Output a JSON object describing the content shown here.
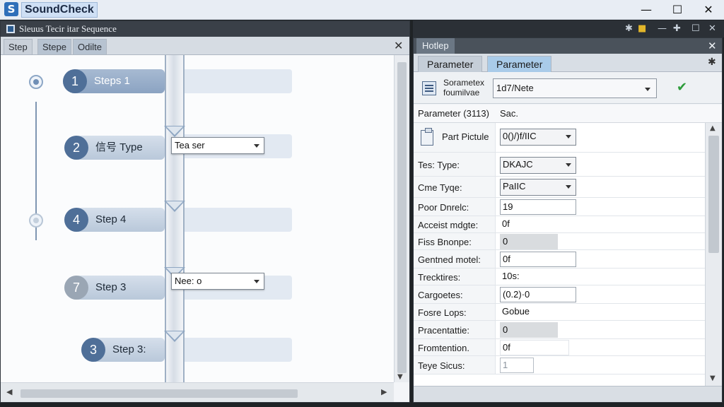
{
  "window": {
    "app_logo": "S",
    "app_title": "SoundCheck",
    "minimize": "—",
    "maximize": "☐",
    "close": "✕"
  },
  "left_pane": {
    "header_title": "Sleuus Tecir itar Sequence",
    "tabs": [
      {
        "label": "Step",
        "active": false
      },
      {
        "label": "Stepe",
        "active": true
      },
      {
        "label": "Odilte",
        "active": true
      }
    ],
    "close": "✕",
    "steps": [
      {
        "number": "1",
        "label": "Steps 1",
        "style": "primary"
      },
      {
        "number": "2",
        "label": "信号 Type",
        "style": "normal"
      },
      {
        "number": "4",
        "label": "Step 4",
        "style": "normal"
      },
      {
        "number": "7",
        "label": "Step 3",
        "style": "grey"
      },
      {
        "number": "3",
        "label": "Step 3:",
        "style": "normal"
      }
    ],
    "combos": [
      {
        "value": "Tea ser"
      },
      {
        "value": "Nee: o"
      }
    ],
    "scroll": {
      "left_arrow": "◀",
      "right_arrow": "▶",
      "down_arrow": "▼"
    }
  },
  "right_pane": {
    "toolbar_icons": [
      "pin-icon",
      "collapse-icon",
      "minimize-icon",
      "restore-icon",
      "close-icon"
    ],
    "header_title": "Hotlep",
    "close": "✕",
    "pin": "✱",
    "tabs": [
      {
        "label": "Parameter",
        "active": false
      },
      {
        "label": "Parameter",
        "active": true
      }
    ],
    "selector": {
      "label": "Sorametex foumilvae",
      "value": "1d7/Nete",
      "confirm": "✔"
    },
    "table_header": {
      "key": "Parameter (3113)",
      "value": "Sac."
    },
    "properties": [
      {
        "key": "Part Pictule",
        "value": "0()/)f/IIC",
        "kind": "dropdown",
        "icon": "clipboard-icon"
      },
      {
        "key": "Tes: Type:",
        "value": "DKAJC",
        "kind": "dropdown"
      },
      {
        "key": "Cme Tyqe:",
        "value": "PaIIC",
        "kind": "dropdown"
      },
      {
        "key": "Poor Dnrelc:",
        "value": "19",
        "kind": "box"
      },
      {
        "key": "Acceist mdgte:",
        "value": "0f",
        "kind": "plain"
      },
      {
        "key": "Fiss Bnonpe:",
        "value": "0",
        "kind": "grey"
      },
      {
        "key": "Gentned motel:",
        "value": "0f",
        "kind": "box"
      },
      {
        "key": "Trecktires:",
        "value": "10s:",
        "kind": "plain"
      },
      {
        "key": "Cargoetes:",
        "value": "(0.2)·0",
        "kind": "box"
      },
      {
        "key": "Fosre Lops:",
        "value": "Gobue",
        "kind": "plain"
      },
      {
        "key": "Pracentattie:",
        "value": "0",
        "kind": "grey"
      },
      {
        "key": "Fromtention.",
        "value": "0f",
        "kind": "box"
      },
      {
        "key": "Teye Sicus:",
        "value": "1",
        "kind": "faint"
      }
    ],
    "scroll": {
      "up": "▲",
      "down": "▼"
    }
  }
}
